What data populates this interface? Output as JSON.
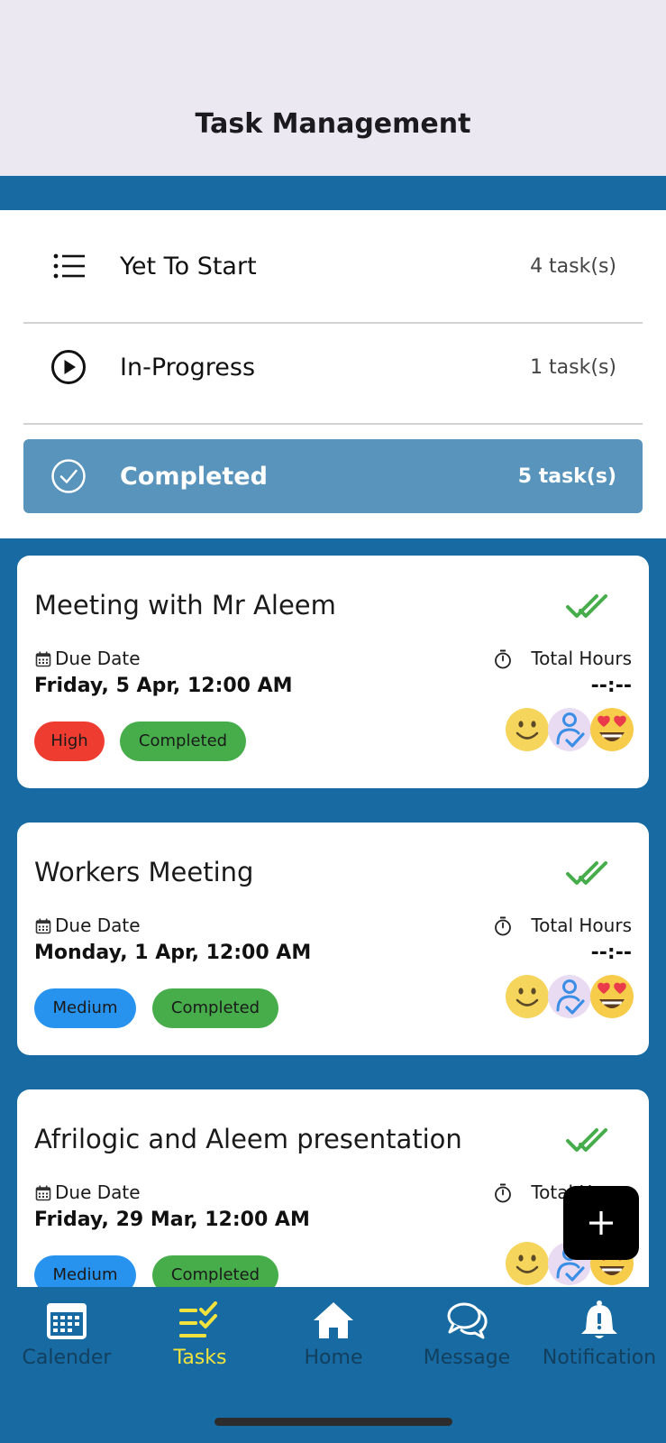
{
  "header": {
    "title": "Task Management"
  },
  "filters": [
    {
      "label": "Yet To Start",
      "count": "4 task(s)",
      "icon": "list-icon",
      "active": false
    },
    {
      "label": "In-Progress",
      "count": "1 task(s)",
      "icon": "play-circle-icon",
      "active": false
    },
    {
      "label": "Completed",
      "count": "5 task(s)",
      "icon": "check-circle-icon",
      "active": true
    }
  ],
  "tasks": [
    {
      "title": "Meeting with Mr Aleem",
      "due_label": "Due Date",
      "due_value": "Friday, 5 Apr, 12:00 AM",
      "hours_label": "Total Hours",
      "hours_value": "--:--",
      "priority": "High",
      "status": "Completed"
    },
    {
      "title": "Workers Meeting",
      "due_label": "Due Date",
      "due_value": "Monday, 1 Apr, 12:00 AM",
      "hours_label": "Total Hours",
      "hours_value": "--:--",
      "priority": "Medium",
      "status": "Completed"
    },
    {
      "title": "Afrilogic and Aleem presentation",
      "due_label": "Due Date",
      "due_value": "Friday, 29 Mar, 12:00 AM",
      "hours_label": "Total Hours",
      "hours_value": "--:--",
      "priority": "Medium",
      "status": "Completed"
    }
  ],
  "fab": {
    "icon": "plus-icon"
  },
  "nav": [
    {
      "label": "Calender",
      "icon": "calendar-icon",
      "active": false
    },
    {
      "label": "Tasks",
      "icon": "tasks-check-icon",
      "active": true
    },
    {
      "label": "Home",
      "icon": "home-icon",
      "active": false
    },
    {
      "label": "Message",
      "icon": "chat-bubbles-icon",
      "active": false
    },
    {
      "label": "Notification",
      "icon": "bell-icon",
      "active": false
    }
  ],
  "colors": {
    "header_bg": "#ebe8f1",
    "brand_blue": "#176ba2",
    "active_filter": "#5894bb",
    "priority_high": "#ef3c30",
    "priority_medium": "#2793ef",
    "status_completed": "#46ad4a",
    "nav_active": "#f1e23e",
    "nav_inactive": "#133f5e"
  }
}
